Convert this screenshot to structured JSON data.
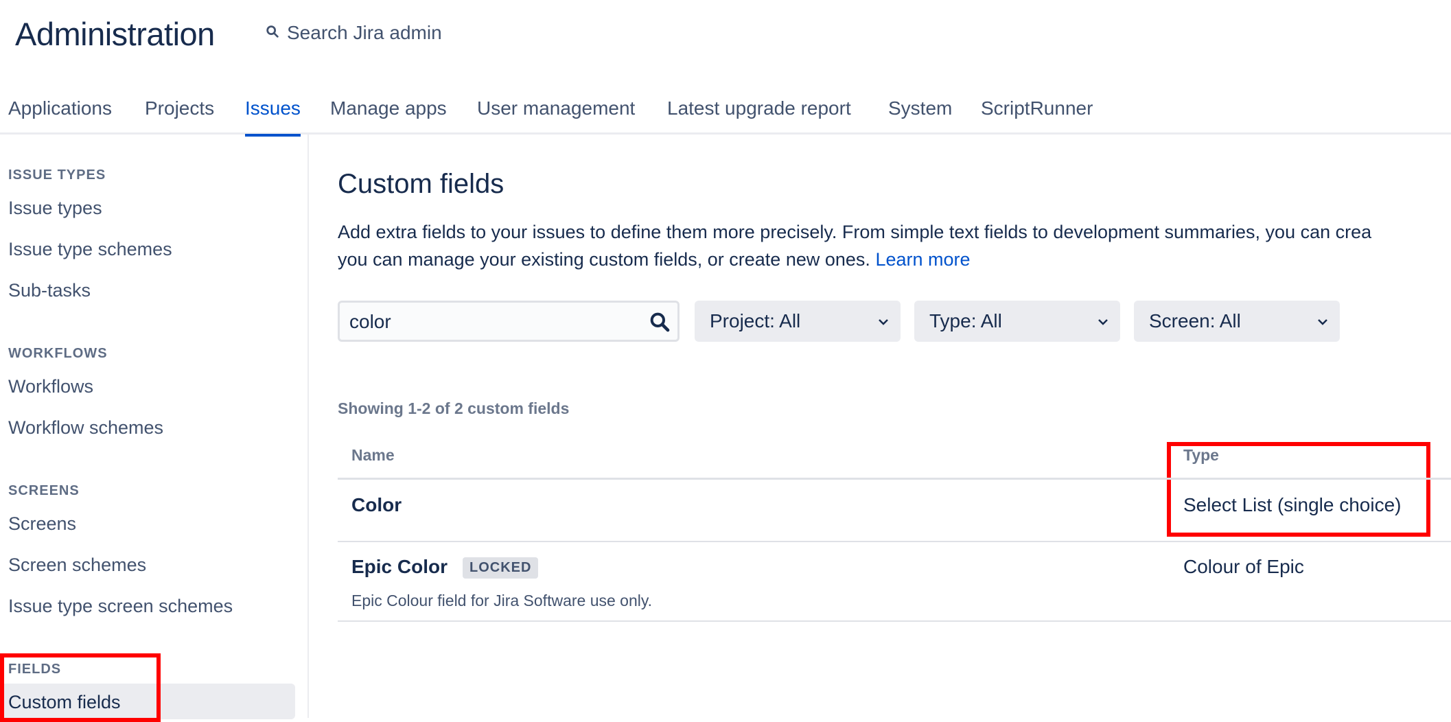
{
  "header": {
    "title": "Administration",
    "search_label": "Search Jira admin"
  },
  "nav": {
    "tabs": [
      {
        "label": "Applications"
      },
      {
        "label": "Projects"
      },
      {
        "label": "Issues",
        "active": true
      },
      {
        "label": "Manage apps"
      },
      {
        "label": "User management"
      },
      {
        "label": "Latest upgrade report"
      },
      {
        "label": "System"
      },
      {
        "label": "ScriptRunner"
      }
    ]
  },
  "sidebar": {
    "sections": [
      {
        "heading": "ISSUE TYPES",
        "items": [
          "Issue types",
          "Issue type schemes",
          "Sub-tasks"
        ]
      },
      {
        "heading": "WORKFLOWS",
        "items": [
          "Workflows",
          "Workflow schemes"
        ]
      },
      {
        "heading": "SCREENS",
        "items": [
          "Screens",
          "Screen schemes",
          "Issue type screen schemes"
        ]
      },
      {
        "heading": "FIELDS",
        "items": [
          "Custom fields"
        ]
      }
    ],
    "selected": "Custom fields"
  },
  "main": {
    "title": "Custom fields",
    "description_line1": "Add extra fields to your issues to define them more precisely. From simple text fields to development summaries, you can crea",
    "description_line2": "you can manage your existing custom fields, or create new ones.",
    "learn_more": "Learn more",
    "search": {
      "value": "color"
    },
    "filters": {
      "project": "Project: All",
      "type": "Type: All",
      "screen": "Screen: All"
    },
    "showing": "Showing 1-2 of 2 custom fields",
    "table": {
      "columns": [
        "Name",
        "Type"
      ],
      "rows": [
        {
          "name": "Color",
          "type": "Select List (single choice)",
          "description": "",
          "badge": ""
        },
        {
          "name": "Epic Color",
          "type": "Colour of Epic",
          "description": "Epic Colour field for Jira Software use only.",
          "badge": "LOCKED"
        }
      ]
    }
  },
  "colors": {
    "accent": "#0052cc",
    "highlight_box": "#ff0000",
    "text": "#172b4d",
    "subtle_text": "#42526e"
  }
}
